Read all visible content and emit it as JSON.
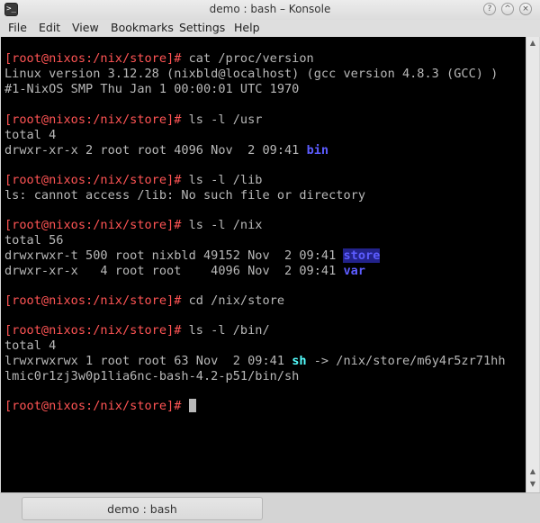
{
  "window": {
    "title": "demo : bash – Konsole",
    "icon_glyph": ">_",
    "controls": {
      "help": "?",
      "minimize": "^",
      "maximize": "^",
      "close": "×"
    }
  },
  "menu": [
    "File",
    "Edit",
    "View",
    "Bookmarks",
    "Settings",
    "Help"
  ],
  "prompt": "[root@nixos:/nix/store]#",
  "terminal": {
    "l1": {
      "cmd": " cat /proc/version"
    },
    "l2": "Linux version 3.12.28 (nixbld@localhost) (gcc version 4.8.3 (GCC) )",
    "l3": "#1-NixOS SMP Thu Jan 1 00:00:01 UTC 1970",
    "l5": {
      "cmd": " ls -l /usr"
    },
    "l6": "total 4",
    "l7": {
      "pre": "drwxr-xr-x 2 root root 4096 Nov  2 09:41 ",
      "name": "bin"
    },
    "l9": {
      "cmd": " ls -l /lib"
    },
    "l10": "ls: cannot access /lib: No such file or directory",
    "l12": {
      "cmd": " ls -l /nix"
    },
    "l13": "total 56",
    "l14": {
      "pre": "drwxrwxr-t 500 root nixbld 49152 Nov  2 09:41 ",
      "name": "store"
    },
    "l15": {
      "pre": "drwxr-xr-x   4 root root    4096 Nov  2 09:41 ",
      "name": "var"
    },
    "l17": {
      "cmd": " cd /nix/store"
    },
    "l19": {
      "cmd": " ls -l /bin/"
    },
    "l20": "total 4",
    "l21": {
      "pre": "lrwxrwxrwx 1 root root 63 Nov  2 09:41 ",
      "name": "sh",
      "post": " -> /nix/store/m6y4r5zr71hh"
    },
    "l22": "lmic0r1zj3w0p1lia6nc-bash-4.2-p51/bin/sh",
    "l24": {
      "cmd": " "
    }
  },
  "tab": {
    "label": "demo : bash"
  },
  "colors": {
    "background": "#000000",
    "foreground": "#b8b8b8",
    "prompt": "#ff5454",
    "directory": "#5c5cff",
    "symlink": "#54ffff"
  }
}
